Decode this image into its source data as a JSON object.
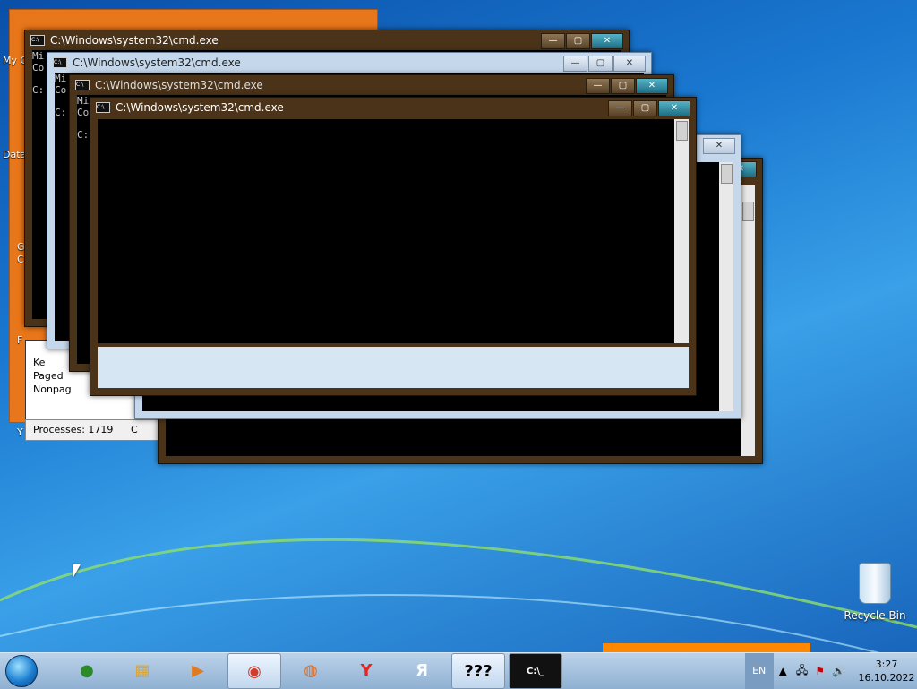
{
  "desktop": {
    "left_labels": [
      "My C",
      "Data",
      "G",
      "C",
      "F",
      "Y"
    ],
    "recycle_bin_label": "Recycle Bin"
  },
  "windows": [
    {
      "title": "C:\\Windows\\system32\\cmd.exe",
      "lines": [
        "Mi",
        "Co",
        "",
        "C:"
      ]
    },
    {
      "title": "C:\\Windows\\system32\\cmd.exe",
      "lines": [
        "Mi",
        "Co",
        "",
        "C:"
      ]
    },
    {
      "title": "C:\\Windows\\system32\\cmd.exe",
      "lines": [
        "Mi",
        "Co",
        "",
        "C:"
      ]
    },
    {
      "title": "C:\\Windows\\system32\\cmd.exe",
      "lines": []
    }
  ],
  "task_manager": {
    "rows": [
      "Ke",
      "Paged",
      "Nonpag"
    ],
    "status": "Processes: 1719",
    "status_extra": "C"
  },
  "taskbar": {
    "items": [
      {
        "name": "antivirus-icon",
        "glyph": "●",
        "color": "#2d8a2a"
      },
      {
        "name": "explorer-icon",
        "glyph": "▦",
        "color": "#d9a63a"
      },
      {
        "name": "media-player-icon",
        "glyph": "▶",
        "color": "#e07a20"
      },
      {
        "name": "chrome-icon",
        "glyph": "◉",
        "color": "#d33b2c"
      },
      {
        "name": "firefox-icon",
        "glyph": "◍",
        "color": "#e76b1b"
      },
      {
        "name": "yandex-browser-icon",
        "glyph": "Y",
        "color": "#e52620"
      },
      {
        "name": "yandex-icon",
        "glyph": "Я",
        "color": "#ffffff"
      },
      {
        "name": "unknown-app-icon",
        "glyph": "???",
        "color": "#000000"
      },
      {
        "name": "cmd-icon",
        "glyph": "C:\\_",
        "color": "#ffffff"
      }
    ],
    "language": "EN",
    "time": "3:27",
    "date": "16.10.2022"
  }
}
